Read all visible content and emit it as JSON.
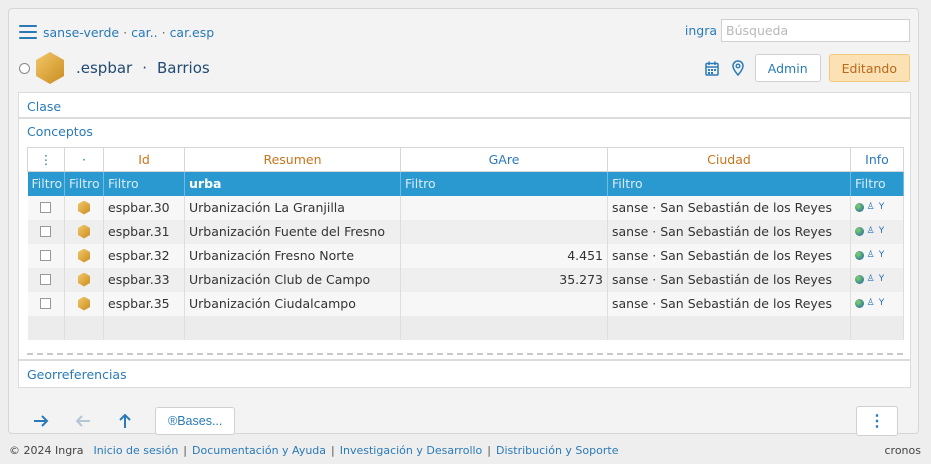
{
  "breadcrumb": {
    "items": [
      "sanse-verde",
      "car..",
      "car.esp"
    ],
    "separator": "·"
  },
  "user": {
    "name": "ingra"
  },
  "search": {
    "placeholder": "Búsqueda",
    "value": ""
  },
  "header": {
    "code": ".espbar",
    "separator": "·",
    "title": "Barrios"
  },
  "actions": {
    "admin_label": "Admin",
    "editing_label": "Editando"
  },
  "sections": {
    "clase": "Clase",
    "conceptos": "Conceptos",
    "georeferencias": "Georreferencias"
  },
  "table": {
    "columns": {
      "dots": "⋮",
      "dot": "·",
      "id": "Id",
      "resumen": "Resumen",
      "gare": "GAre",
      "ciudad": "Ciudad",
      "info": "Info"
    },
    "filters": {
      "c0": "Filtro",
      "c1": "Filtro",
      "id": "Filtro",
      "resumen": "urba",
      "gare": "Filtro",
      "ciudad": "Filtro",
      "info": "Filtro"
    },
    "rows": [
      {
        "id": "espbar.30",
        "resumen": "Urbanización La Granjilla",
        "gare": "",
        "ciudad": "sanse · San Sebastián de los Reyes"
      },
      {
        "id": "espbar.31",
        "resumen": "Urbanización Fuente del Fresno",
        "gare": "",
        "ciudad": "sanse · San Sebastián de los Reyes"
      },
      {
        "id": "espbar.32",
        "resumen": "Urbanización Fresno Norte",
        "gare": "4.451",
        "ciudad": "sanse · San Sebastián de los Reyes"
      },
      {
        "id": "espbar.33",
        "resumen": "Urbanización Club de Campo",
        "gare": "35.273",
        "ciudad": "sanse · San Sebastián de los Reyes"
      },
      {
        "id": "espbar.35",
        "resumen": "Urbanización Ciudalcampo",
        "gare": "",
        "ciudad": "sanse · San Sebastián de los Reyes"
      }
    ]
  },
  "bottom": {
    "bases_label": "®Bases..."
  },
  "footer": {
    "copyright": "© 2024 Ingra",
    "links": [
      "Inicio de sesión",
      "Documentación y Ayuda",
      "Investigación y Desarrollo",
      "Distribución y Soporte"
    ],
    "right": "cronos"
  },
  "colors": {
    "accent": "#2a7ab8",
    "filter_bar": "#2a99d0",
    "header_text": "#c8741b",
    "editing_bg": "#fbe1b4"
  }
}
